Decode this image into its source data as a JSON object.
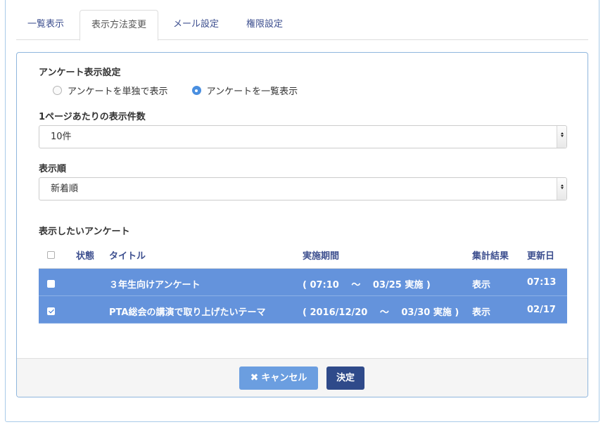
{
  "tabs": [
    {
      "label": "一覧表示",
      "active": false
    },
    {
      "label": "表示方法変更",
      "active": true
    },
    {
      "label": "メール設定",
      "active": false
    },
    {
      "label": "権限設定",
      "active": false
    }
  ],
  "display_settings": {
    "title": "アンケート表示設定",
    "options": [
      {
        "label": "アンケートを単独で表示",
        "checked": false
      },
      {
        "label": "アンケートを一覧表示",
        "checked": true
      }
    ]
  },
  "per_page": {
    "label": "1ページあたりの表示件数",
    "selected": "10件"
  },
  "sort_order": {
    "label": "表示順",
    "selected": "新着順"
  },
  "survey_table": {
    "title": "表示したいアンケート",
    "headers": {
      "status": "状態",
      "title": "タイトル",
      "period": "実施期間",
      "result": "集計結果",
      "updated": "更新日"
    },
    "rows": [
      {
        "checked": false,
        "title": "３年生向けアンケート",
        "period": "( 07:10　 〜　 03/25 実施 )",
        "result": "表示",
        "updated": "07:13"
      },
      {
        "checked": true,
        "title": "PTA総会の講演で取り上げたいテーマ",
        "period": "( 2016/12/20　 〜　 03/30 実施 )",
        "result": "表示",
        "updated": "02/17"
      }
    ]
  },
  "footer": {
    "cancel_label": "キャンセル",
    "ok_label": "決定"
  },
  "colors": {
    "accent": "#3d4f8f",
    "row_highlight": "#6493dc",
    "cancel_button": "#6b9ee0",
    "ok_button": "#2f4a8a",
    "radio_checked": "#4a8fe0"
  },
  "icons": {
    "cancel": "close-icon",
    "select_arrow": "select-arrows-icon"
  }
}
